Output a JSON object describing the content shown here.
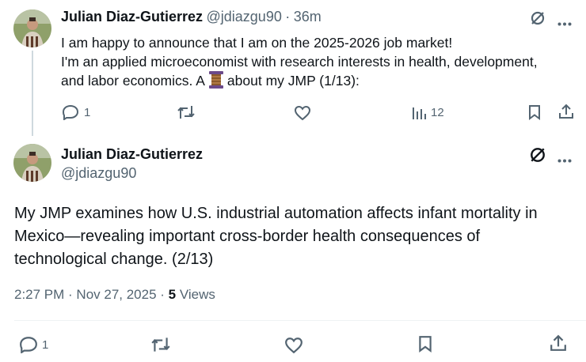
{
  "tweet1": {
    "display_name": "Julian Diaz-Gutierrez",
    "handle": "@jdiazgu90",
    "separator": "·",
    "time": "36m",
    "lines": [
      "I am happy to announce that I am on the 2025-2026 job market!",
      "I'm an applied microeconomist with research interests in health, development,"
    ],
    "line3_before": "and labor economics.  A",
    "line3_after": "about my JMP (1/13):",
    "reply_count": "1",
    "views_count": "12"
  },
  "tweet2": {
    "display_name": "Julian Diaz-Gutierrez",
    "handle": "@jdiazgu90",
    "lines": [
      "My JMP examines how U.S. industrial automation affects infant mortality in",
      "Mexico—revealing important cross-border health consequences of",
      "technological change. (2/13)"
    ],
    "timestamp": "2:27 PM · Nov 27, 2025 · ",
    "views_count": "5",
    "views_label": " Views",
    "reply_count": "1"
  },
  "colors": {
    "text": "#0f1419",
    "secondary": "#536471",
    "divider": "#eff3f4"
  },
  "icons": [
    "grok-icon",
    "more-icon",
    "reply-icon",
    "retweet-icon",
    "like-icon",
    "analytics-icon",
    "bookmark-icon",
    "share-icon",
    "thread-spool-icon"
  ]
}
